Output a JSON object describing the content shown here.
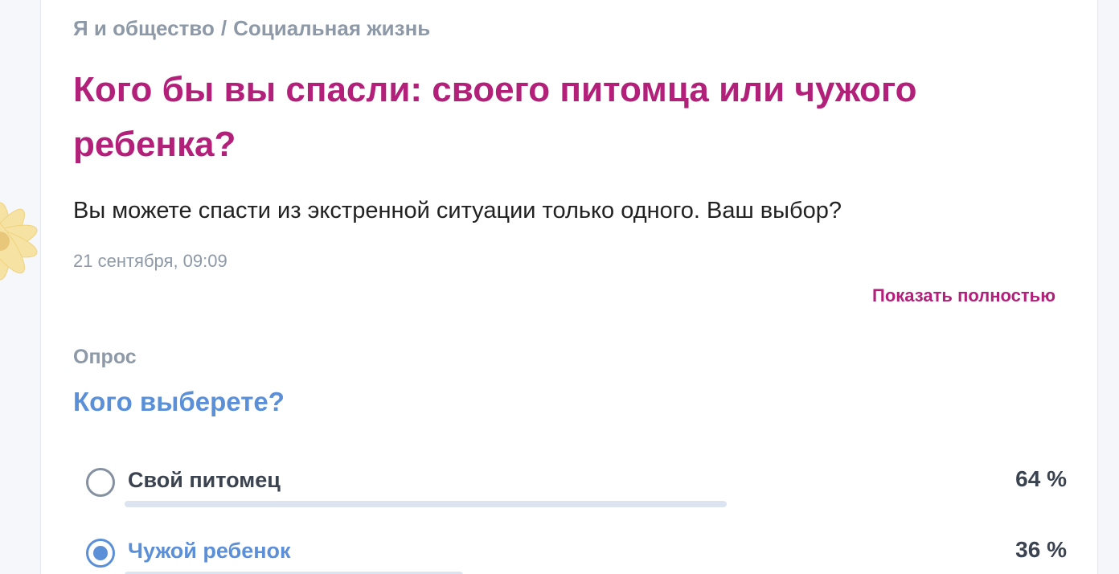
{
  "breadcrumb": {
    "category": "Я и общество",
    "separator": "/",
    "subcategory": "Социальная жизнь"
  },
  "post": {
    "title": "Кого бы вы спасли: своего питомца или чужого ребенка?",
    "description": "Вы можете спасти из экстренной ситуации только одного. Ваш выбор?",
    "date": "21 сентября, 09:09",
    "show_full_label": "Показать полностью"
  },
  "poll": {
    "label": "Опрос",
    "question": "Кого выберете?",
    "options": [
      {
        "label": "Свой питомец",
        "percent_text": "64 %",
        "share": 0.64,
        "selected": false
      },
      {
        "label": "Чужой ребенок",
        "percent_text": "36 %",
        "share": 0.36,
        "selected": true
      }
    ]
  },
  "colors": {
    "accent_magenta": "#b2207a",
    "accent_blue": "#5b8fd8",
    "muted_gray": "#8e99a8",
    "bar_fill": "#dde4f1"
  },
  "icons": {
    "radio_unchecked": "radio-unchecked-icon",
    "radio_checked": "radio-checked-icon",
    "decoration": "flower-icon"
  }
}
